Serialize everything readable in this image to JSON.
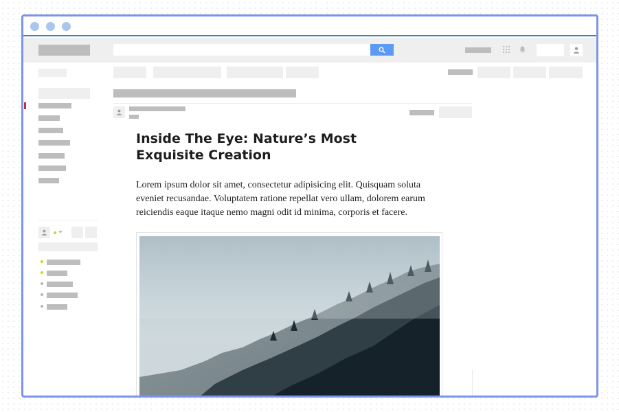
{
  "article": {
    "title": "Inside The Eye: Nature’s Most Exquisite Creation",
    "body": "Lorem ipsum dolor sit amet, consectetur adipisicing elit. Quisquam soluta eveniet recusandae. Voluptatem ratione repellat vero ullam, dolorem earum reiciendis eaque itaque nemo magni odit id minima, corporis et facere."
  },
  "icons": {
    "search": "search-icon",
    "apps": "apps-grid-icon",
    "notifications": "bell-icon",
    "account": "user-icon",
    "author_avatar": "user-icon",
    "profile_avatar": "user-icon",
    "dropdown": "chevron-down-icon"
  },
  "colors": {
    "window_border": "#7b93ea",
    "search_button": "#5b9bf3",
    "window_dots": "#a9c6ee",
    "active_indicator": "#c0304a",
    "online_status": "#c8d81c",
    "placeholder": "#bdbdbd"
  }
}
